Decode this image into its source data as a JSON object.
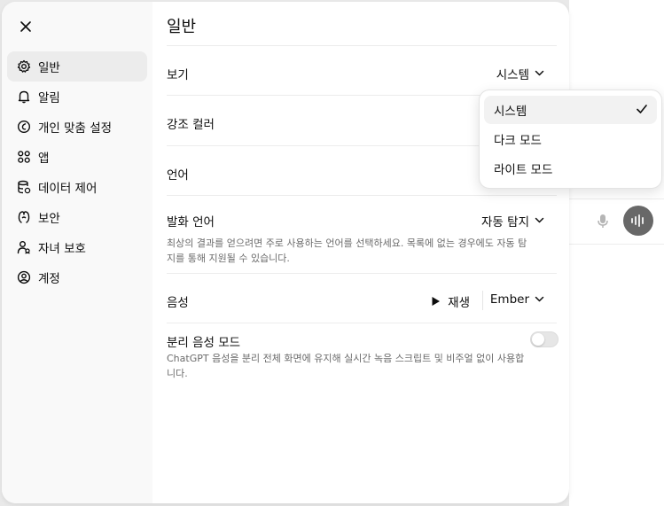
{
  "sidebar": {
    "items": [
      {
        "label": "일반",
        "icon": "gear-icon"
      },
      {
        "label": "알림",
        "icon": "bell-icon"
      },
      {
        "label": "개인 맞춤 설정",
        "icon": "personalization-icon"
      },
      {
        "label": "앱",
        "icon": "apps-grid-icon"
      },
      {
        "label": "데이터 제어",
        "icon": "data-control-icon"
      },
      {
        "label": "보안",
        "icon": "security-icon"
      },
      {
        "label": "자녀 보호",
        "icon": "parental-control-icon"
      },
      {
        "label": "계정",
        "icon": "account-icon"
      }
    ]
  },
  "general": {
    "title": "일반",
    "view_label": "보기",
    "view_value": "시스템",
    "accent_label": "강조 컬러",
    "language_label": "언어",
    "speech_language_label": "발화 언어",
    "speech_language_value": "자동 탐지",
    "speech_language_desc": "최상의 결과를 얻으려면 주로 사용하는 언어를 선택하세요. 목록에 없는 경우에도 자동 탐지를 통해 지원될 수 있습니다.",
    "voice_label": "음성",
    "play_label": "재생",
    "voice_value": "Ember",
    "separate_voice_label": "분리 음성 모드",
    "separate_voice_desc": "ChatGPT 음성을 분리 전체 화면에 유지해 실시간 녹음 스크립트 및 비주얼 없이 사용합니다.",
    "separate_voice_enabled": false
  },
  "theme_menu": {
    "options": [
      "시스템",
      "다크 모드",
      "라이트 모드"
    ],
    "selected": "시스템"
  },
  "colors": {
    "sidebar_bg": "#f9f9f9",
    "active_item_bg": "#ececec",
    "voice_button_bg": "#686868"
  }
}
